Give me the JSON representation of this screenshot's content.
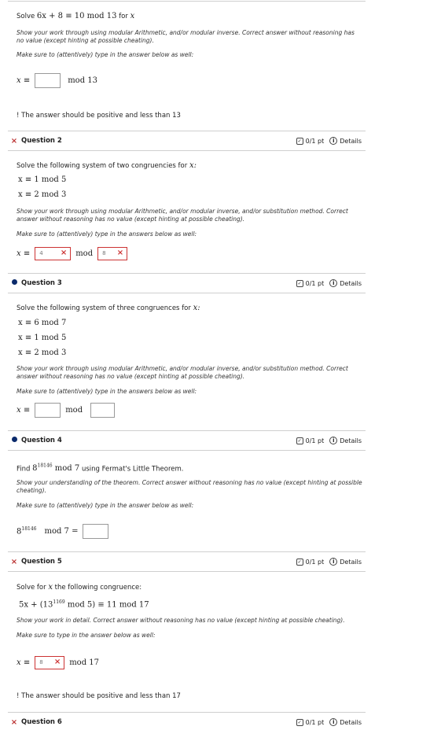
{
  "q1": {
    "prompt_text": "Solve",
    "equation": "6x + 8 ≡ 10  mod 13",
    "for_text": "for",
    "var": "x",
    "note": "Show your work through using modular Arithmetic, and/or modular inverse. Correct answer without reasoning has no value (except hinting at possible cheating).",
    "make_sure": "Make sure to (attentively) type in the answer below as well:",
    "answer_prefix": "x ≡",
    "answer_suffix": "mod 13",
    "warning": "! The answer should be positive and less than 13"
  },
  "q2": {
    "name": "Question 2",
    "score": "0/1 pt",
    "details": "Details",
    "prompt": "Solve the following system of two congruencies for",
    "var": "x:",
    "eq1": "x ≡ 1 mod 5",
    "eq2": "x ≡ 2 mod 3",
    "note": "Show your work through using modular Arithmetic, and/or modular inverse, and/or substitution method. Correct answer without reasoning has no value (except hinting at possible cheating).",
    "make_sure": "Make sure to (attentively) type in the answers below as well:",
    "answer_prefix": "x ≡",
    "answer_value": "4",
    "mod_label": "mod",
    "mod_value": "8"
  },
  "q3": {
    "name": "Question 3",
    "score": "0/1 pt",
    "details": "Details",
    "prompt": "Solve the following system of three congruences for",
    "var": "x:",
    "eq1": "x ≡ 6 mod 7",
    "eq2": "x ≡ 1 mod 5",
    "eq3": "x ≡ 2 mod 3",
    "note": "Show your work through using modular Arithmetic, and/or modular inverse, and/or substitution method. Correct answer without reasoning has no value (except hinting at possible cheating).",
    "make_sure": "Make sure to (attentively) type in the answers below as well:",
    "answer_prefix": "x ≡",
    "mod_label": "mod"
  },
  "q4": {
    "name": "Question 4",
    "score": "0/1 pt",
    "details": "Details",
    "prompt_find": "Find",
    "base": "8",
    "exp": "18146",
    "mod_text": "mod 7",
    "prompt_rest": "using Fermat's Little Theorem.",
    "note": "Show your understanding of the theorem. Correct answer without reasoning has no value (except hinting at possible cheating).",
    "make_sure": "Make sure to (attentively) type in the answer below as well:",
    "answer_suffix": "mod 7 ="
  },
  "q5": {
    "name": "Question 5",
    "score": "0/1 pt",
    "details": "Details",
    "prompt_a": "Solve for",
    "var": "x",
    "prompt_b": "the following congruence:",
    "eq_left": "5x + (13",
    "eq_exp": "1169",
    "eq_right": " mod 5) ≡ 11  mod 17",
    "note": "Show your work in detail. Correct answer without reasoning has no value (except hinting at possible cheating).",
    "make_sure": "Make sure to type in the answer below as well:",
    "answer_prefix": "x ≡",
    "answer_value": "8",
    "answer_suffix": "mod 17",
    "warning": "! The answer should be positive and less than 17"
  },
  "q6": {
    "name": "Question 6",
    "score": "0/1 pt",
    "details": "Details"
  },
  "colors": {
    "wrong": "#cc3333",
    "unanswered_dot": "#0b2a6b",
    "separator": "#cfcfcf"
  }
}
